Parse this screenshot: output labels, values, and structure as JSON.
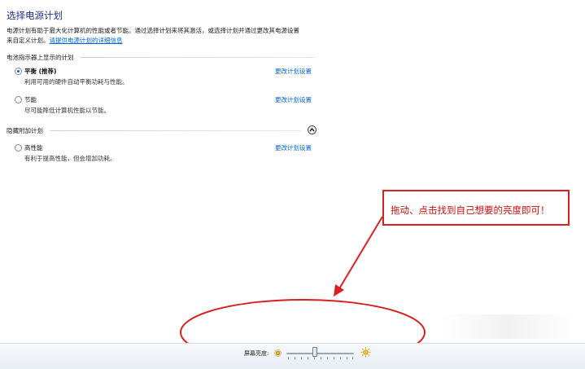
{
  "header": {
    "title": "选择电源计划"
  },
  "description": {
    "line1": "电源计划有助于最大化计算机的性能或者节能。通过选择计划来将其激活，或选择计划并通过更改其电源设置",
    "line2_prefix": "来自定义计划。",
    "link": "请提供电源计划的详细信息"
  },
  "battery_group": {
    "header": "电池指示器上显示的计划",
    "plans": [
      {
        "name": "平衡 (推荐)",
        "desc": "利用可用的硬件自动平衡功耗与性能。",
        "change": "更改计划设置",
        "selected": true
      },
      {
        "name": "节能",
        "desc": "尽可能降低计算机性能以节能。",
        "change": "更改计划设置",
        "selected": false
      }
    ]
  },
  "hidden_group": {
    "header": "隐藏附加计划",
    "plans": [
      {
        "name": "高性能",
        "desc": "有利于提高性能，但会增加功耗。",
        "change": "更改计划设置",
        "selected": false
      }
    ]
  },
  "callout": {
    "text": "拖动、点击找到自己想要的亮度即可！"
  },
  "brightness": {
    "label": "屏幕亮度:",
    "level": 0.42
  },
  "colors": {
    "title": "#1e3287",
    "link": "#0066cc",
    "annotation": "#d72020",
    "callout_text": "#c80f0f"
  }
}
